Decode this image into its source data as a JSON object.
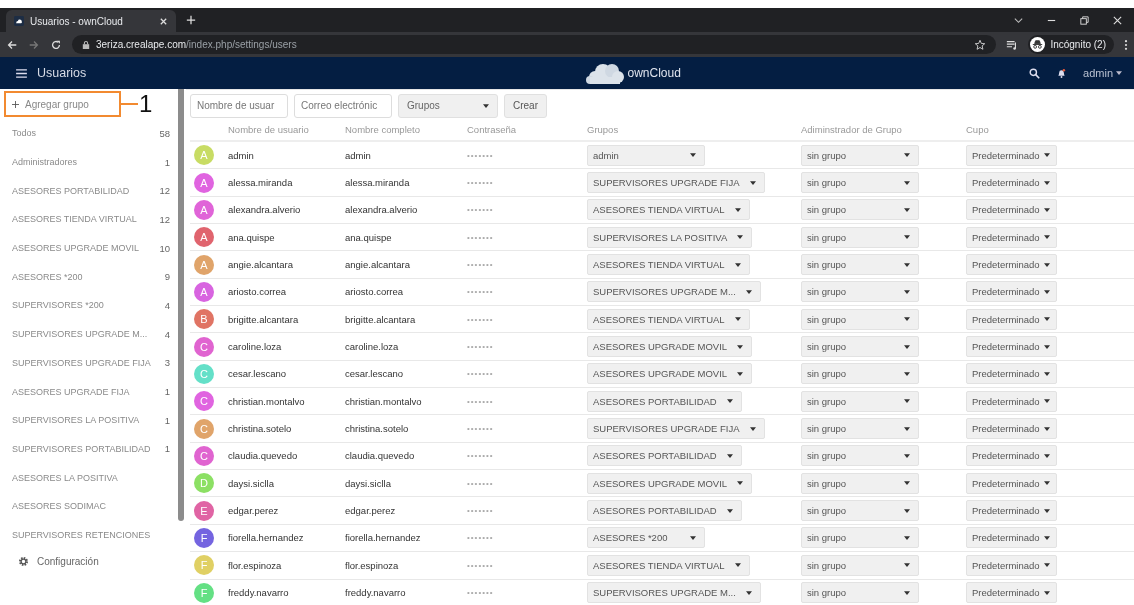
{
  "browser": {
    "tab_title": "Usuarios - ownCloud",
    "url_host": "3eriza.crealape.com",
    "url_path": "/index.php/settings/users",
    "profile": "Incógnito (2)"
  },
  "header": {
    "title": "Usuarios",
    "brand": "ownCloud",
    "user": "admin"
  },
  "sidebar": {
    "add_group": "Agregar grupo",
    "annotation": "1",
    "groups": [
      {
        "name": "Todos",
        "count": "58"
      },
      {
        "name": "Administradores",
        "count": "1"
      },
      {
        "name": "ASESORES PORTABILIDAD",
        "count": "12"
      },
      {
        "name": "ASESORES TIENDA VIRTUAL",
        "count": "12"
      },
      {
        "name": "ASESORES UPGRADE MOVIL",
        "count": "10"
      },
      {
        "name": "ASESORES *200",
        "count": "9"
      },
      {
        "name": "SUPERVISORES *200",
        "count": "4"
      },
      {
        "name": "SUPERVISORES UPGRADE M...",
        "count": "4"
      },
      {
        "name": "SUPERVISORES UPGRADE FIJA",
        "count": "3"
      },
      {
        "name": "ASESORES UPGRADE FIJA",
        "count": "1"
      },
      {
        "name": "SUPERVISORES LA POSITIVA",
        "count": "1"
      },
      {
        "name": "SUPERVISORES PORTABILIDAD",
        "count": "1"
      },
      {
        "name": "ASESORES LA POSITIVA"
      },
      {
        "name": "ASESORES SODIMAC"
      },
      {
        "name": "SUPERVISORES RETENCIONES"
      }
    ],
    "settings": "Configuración"
  },
  "new_user": {
    "username_placeholder": "Nombre de usuar",
    "email_placeholder": "Correo electrónic",
    "groups": "Grupos",
    "create": "Crear"
  },
  "table": {
    "columns": [
      "Nombre de usuario",
      "Nombre completo",
      "Contraseña",
      "Grupos",
      "Adiminstrador de Grupo",
      "Cupo"
    ],
    "rows": [
      {
        "initial": "A",
        "color": "#c8dc64",
        "username": "admin",
        "full_name": "admin",
        "password": "•••••••",
        "groups": "admin",
        "group_admin": "sin grupo",
        "quota": "Predeterminado"
      },
      {
        "initial": "A",
        "color": "#e064e0",
        "username": "alessa.miranda",
        "full_name": "alessa.miranda",
        "password": "•••••••",
        "groups": "SUPERVISORES UPGRADE FIJA",
        "group_admin": "sin grupo",
        "quota": "Predeterminado"
      },
      {
        "initial": "A",
        "color": "#e064d8",
        "username": "alexandra.alverio",
        "full_name": "alexandra.alverio",
        "password": "•••••••",
        "groups": "ASESORES TIENDA VIRTUAL",
        "group_admin": "sin grupo",
        "quota": "Predeterminado"
      },
      {
        "initial": "A",
        "color": "#e0646e",
        "username": "ana.quispe",
        "full_name": "ana.quispe",
        "password": "•••••••",
        "groups": "SUPERVISORES LA POSITIVA",
        "group_admin": "sin grupo",
        "quota": "Predeterminado"
      },
      {
        "initial": "A",
        "color": "#e0a46a",
        "username": "angie.alcantara",
        "full_name": "angie.alcantara",
        "password": "•••••••",
        "groups": "ASESORES TIENDA VIRTUAL",
        "group_admin": "sin grupo",
        "quota": "Predeterminado"
      },
      {
        "initial": "A",
        "color": "#d864e0",
        "username": "ariosto.correa",
        "full_name": "ariosto.correa",
        "password": "•••••••",
        "groups": "SUPERVISORES UPGRADE M...",
        "group_admin": "sin grupo",
        "quota": "Predeterminado"
      },
      {
        "initial": "B",
        "color": "#e07464",
        "username": "brigitte.alcantara",
        "full_name": "brigitte.alcantara",
        "password": "•••••••",
        "groups": "ASESORES TIENDA VIRTUAL",
        "group_admin": "sin grupo",
        "quota": "Predeterminado"
      },
      {
        "initial": "C",
        "color": "#e064d0",
        "username": "caroline.loza",
        "full_name": "caroline.loza",
        "password": "•••••••",
        "groups": "ASESORES UPGRADE MOVIL",
        "group_admin": "sin grupo",
        "quota": "Predeterminado"
      },
      {
        "initial": "C",
        "color": "#64e0c8",
        "username": "cesar.lescano",
        "full_name": "cesar.lescano",
        "password": "•••••••",
        "groups": "ASESORES UPGRADE MOVIL",
        "group_admin": "sin grupo",
        "quota": "Predeterminado"
      },
      {
        "initial": "C",
        "color": "#e064e0",
        "username": "christian.montalvo",
        "full_name": "christian.montalvo",
        "password": "•••••••",
        "groups": "ASESORES PORTABILIDAD",
        "group_admin": "sin grupo",
        "quota": "Predeterminado"
      },
      {
        "initial": "C",
        "color": "#e0a46a",
        "username": "christina.sotelo",
        "full_name": "christina.sotelo",
        "password": "•••••••",
        "groups": "SUPERVISORES UPGRADE FIJA",
        "group_admin": "sin grupo",
        "quota": "Predeterminado"
      },
      {
        "initial": "C",
        "color": "#e064d0",
        "username": "claudia.quevedo",
        "full_name": "claudia.quevedo",
        "password": "•••••••",
        "groups": "ASESORES PORTABILIDAD",
        "group_admin": "sin grupo",
        "quota": "Predeterminado"
      },
      {
        "initial": "D",
        "color": "#8ce064",
        "username": "daysi.siclla",
        "full_name": "daysi.siclla",
        "password": "•••••••",
        "groups": "ASESORES UPGRADE MOVIL",
        "group_admin": "sin grupo",
        "quota": "Predeterminado"
      },
      {
        "initial": "E",
        "color": "#e064a4",
        "username": "edgar.perez",
        "full_name": "edgar.perez",
        "password": "•••••••",
        "groups": "ASESORES PORTABILIDAD",
        "group_admin": "sin grupo",
        "quota": "Predeterminado"
      },
      {
        "initial": "F",
        "color": "#7464e0",
        "username": "fiorella.hernandez",
        "full_name": "fiorella.hernandez",
        "password": "•••••••",
        "groups": "ASESORES *200",
        "group_admin": "sin grupo",
        "quota": "Predeterminado"
      },
      {
        "initial": "F",
        "color": "#e0d064",
        "username": "flor.espinoza",
        "full_name": "flor.espinoza",
        "password": "•••••••",
        "groups": "ASESORES TIENDA VIRTUAL",
        "group_admin": "sin grupo",
        "quota": "Predeterminado"
      },
      {
        "initial": "F",
        "color": "#64e084",
        "username": "freddy.navarro",
        "full_name": "freddy.navarro",
        "password": "•••••••",
        "groups": "SUPERVISORES UPGRADE M...",
        "group_admin": "sin grupo",
        "quota": "Predeterminado"
      }
    ]
  }
}
